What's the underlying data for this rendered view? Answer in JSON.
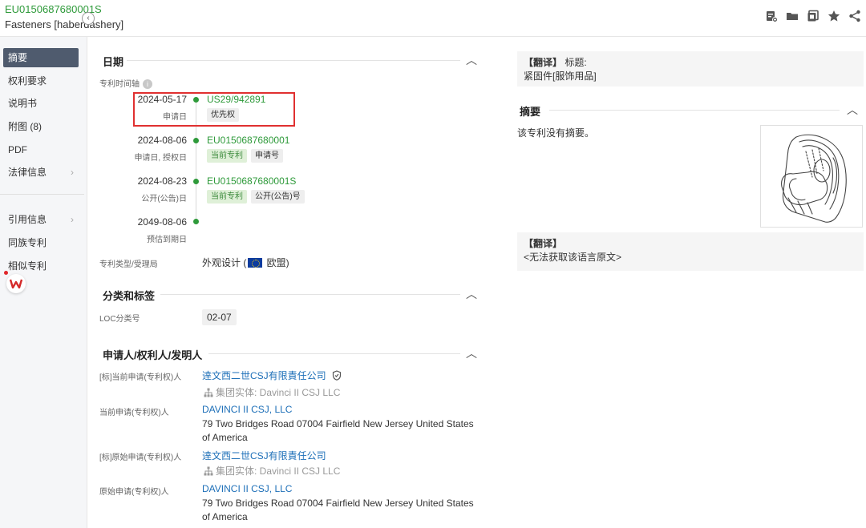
{
  "header": {
    "pub_no": "EU0150687680001S",
    "title": "Fasteners [haberdashery]",
    "tools": [
      "add-note-icon",
      "folder-icon",
      "copy-icon",
      "star-icon",
      "share-icon"
    ]
  },
  "sidebar": {
    "items": [
      {
        "label": "摘要",
        "active": true
      },
      {
        "label": "权利要求"
      },
      {
        "label": "说明书"
      },
      {
        "label": "附图 (8)"
      },
      {
        "label": "PDF"
      },
      {
        "label": "法律信息",
        "chevron": "›"
      },
      {
        "label": "引用信息",
        "chevron": "›"
      },
      {
        "label": "同族专利"
      },
      {
        "label": "相似专利"
      }
    ]
  },
  "dates": {
    "heading": "日期",
    "timeline_label": "专利时间轴",
    "events": [
      {
        "date": "2024-05-17",
        "sub": "申请日",
        "link": "US29/942891",
        "tags": [
          "优先权"
        ]
      },
      {
        "date": "2024-08-06",
        "sub": "申请日, 授权日",
        "link": "EU0150687680001",
        "tags": [
          "当前专利",
          "申请号"
        ]
      },
      {
        "date": "2024-08-23",
        "sub": "公开(公告)日",
        "link": "EU0150687680001S",
        "tags": [
          "当前专利",
          "公开(公告)号"
        ]
      },
      {
        "date": "2049-08-06",
        "sub": "预估到期日"
      }
    ],
    "type_label": "专利类型/受理局",
    "type_value_pre": "外观设计 (",
    "type_value_post": " 欧盟)"
  },
  "classification": {
    "heading": "分类和标签",
    "loc_label": "LOC分类号",
    "loc_value": "02-07"
  },
  "parties": {
    "heading": "申请人/权利人/发明人",
    "rows": [
      {
        "label": "[标]当前申请(专利权)人",
        "name": "逹文西二世CSJ有限責任公司",
        "group": "集团实体:  Davinci II CSJ LLC"
      },
      {
        "label": "当前申请(专利权)人",
        "name": "DAVINCI II CSJ, LLC",
        "address": "79 Two Bridges Road 07004 Fairfield New Jersey United States of America"
      },
      {
        "label": "[标]原始申请(专利权)人",
        "name": "逹文西二世CSJ有限責任公司",
        "group": "集团实体:  Davinci II CSJ LLC"
      },
      {
        "label": "原始申请(专利权)人",
        "name": "DAVINCI II CSJ, LLC",
        "address": "79 Two Bridges Road 07004 Fairfield New Jersey United States of America"
      }
    ]
  },
  "right": {
    "translate_title_tag": "【翻译】",
    "translate_title_label": "标题:",
    "translate_title_value": "紧固件[服饰用品]",
    "abstract_heading": "摘要",
    "abstract_text": "该专利没有摘要。",
    "translate2_tag": "【翻译】",
    "translate2_text": "<无法获取该语言原文>"
  },
  "colors": {
    "accent": "#2e9a3a",
    "link": "#1d6fb8",
    "highlight_box": "#e03030",
    "nav_active": "#4f5b6e"
  }
}
